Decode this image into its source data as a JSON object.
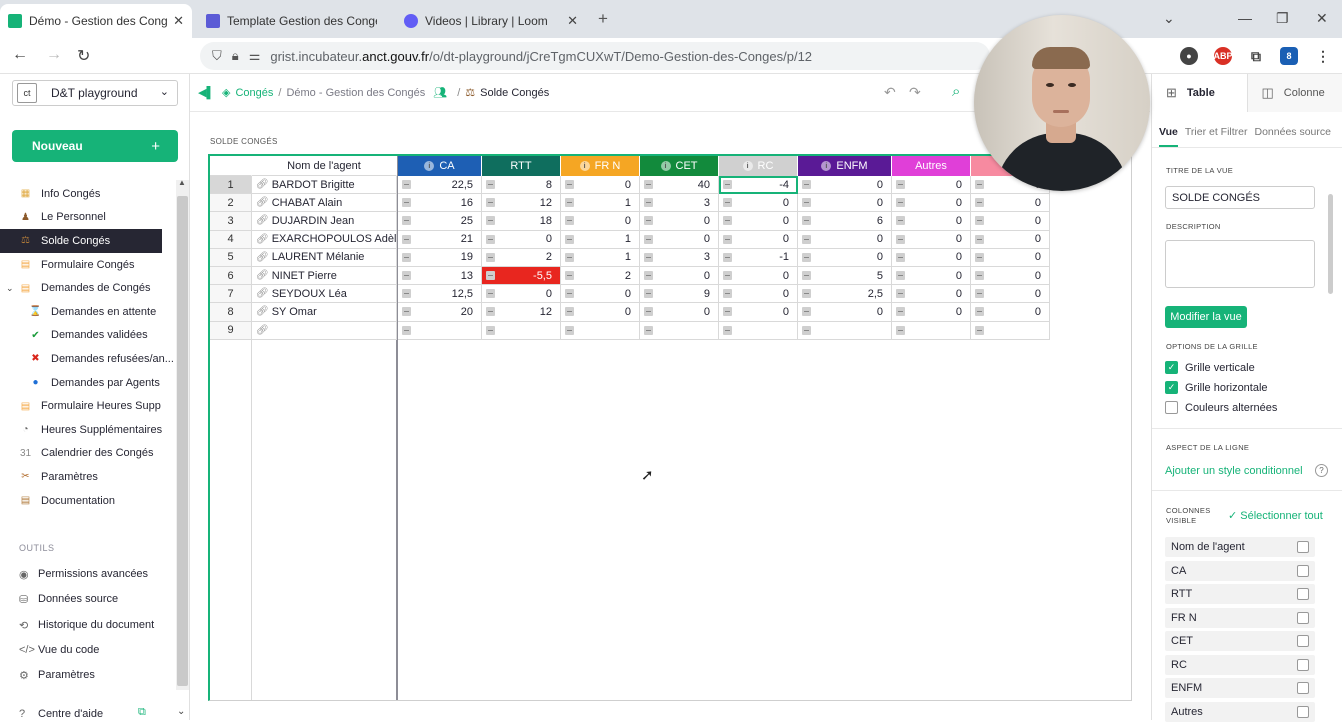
{
  "browser": {
    "tabs": [
      {
        "title": "Démo - Gestion des Congés - G",
        "icon_color": "#16b378"
      },
      {
        "title": "Template Gestion des Congés e",
        "icon_color": "#5b5bd6"
      },
      {
        "title": "Videos | Library | Loom",
        "icon_color": "#625df5"
      }
    ],
    "url_prefix": "grist.incubateur.",
    "url_domain": "anct.gouv.fr",
    "url_path": "/o/dt-playground/jCreTgmCUXwT/Demo-Gestion-des-Conges/p/12",
    "ext_badge": "8",
    "abp_label": "ABP"
  },
  "left": {
    "org_name": "D&T playground",
    "org_logo": "ct",
    "new_label": "Nouveau",
    "pages": [
      {
        "label": "Info Congés",
        "icon": "calendar-table-icon",
        "color": "#e0a940",
        "sub": false,
        "selected": false
      },
      {
        "label": "Le Personnel",
        "icon": "people-icon",
        "color": "#8b5a2b",
        "sub": false,
        "selected": false
      },
      {
        "label": "Solde Congés",
        "icon": "scale-icon",
        "color": "#b07a3a",
        "sub": false,
        "selected": true
      },
      {
        "label": "Formulaire Congés",
        "icon": "form-icon",
        "color": "#f4a640",
        "sub": false,
        "selected": false
      },
      {
        "label": "Demandes de Congés",
        "icon": "file-icon",
        "color": "#f4a640",
        "sub": false,
        "selected": false,
        "toggle": true
      },
      {
        "label": "Demandes en attente",
        "icon": "hourglass-icon",
        "color": "#c18a45",
        "sub": true,
        "selected": false
      },
      {
        "label": "Demandes validées",
        "icon": "checkmark-icon",
        "color": "#1a9b3a",
        "sub": true,
        "selected": false
      },
      {
        "label": "Demandes refusées/an...",
        "icon": "cross-icon",
        "color": "#d9261c",
        "sub": true,
        "selected": false
      },
      {
        "label": "Demandes par Agents",
        "icon": "globe-icon",
        "color": "#1e6fd6",
        "sub": true,
        "selected": false
      },
      {
        "label": "Formulaire Heures Supp",
        "icon": "form-icon",
        "color": "#f4a640",
        "sub": false,
        "selected": false
      },
      {
        "label": "Heures Supplémentaires",
        "icon": "stopwatch-icon",
        "color": "#666666",
        "sub": false,
        "selected": false
      },
      {
        "label": "Calendrier des Congés",
        "icon": "calendar-icon",
        "color": "#888888",
        "sub": false,
        "selected": false
      },
      {
        "label": "Paramètres",
        "icon": "tools-icon",
        "color": "#b06a2a",
        "sub": false,
        "selected": false
      },
      {
        "label": "Documentation",
        "icon": "document-icon",
        "color": "#b07a3a",
        "sub": false,
        "selected": false
      }
    ],
    "tools_title": "OUTILS",
    "tools": [
      {
        "label": "Permissions avancées",
        "icon": "eye-icon"
      },
      {
        "label": "Données source",
        "icon": "database-icon"
      },
      {
        "label": "Historique du document",
        "icon": "history-icon"
      },
      {
        "label": "Vue du code",
        "icon": "code-icon"
      },
      {
        "label": "Paramètres",
        "icon": "gear-icon"
      }
    ],
    "help_label": "Centre d'aide"
  },
  "topbar": {
    "crumb_site": "Congés",
    "crumb_doc": "Démo - Gestion des Congés",
    "crumb_page": "Solde Congés"
  },
  "grid": {
    "view_title": "SOLDE CONGÉS",
    "name_header": "Nom de l'agent",
    "columns": [
      {
        "label": "CA",
        "color": "#1e5fb4",
        "info": true
      },
      {
        "label": "RTT",
        "color": "#0f6e5e",
        "info": false
      },
      {
        "label": "FR N",
        "color": "#f5a623",
        "info": true
      },
      {
        "label": "CET",
        "color": "#128a3c",
        "info": true
      },
      {
        "label": "RC",
        "color": "#d0d0d0",
        "info": true
      },
      {
        "label": "ENFM",
        "color": "#5a1a96",
        "info": true
      },
      {
        "label": "Autres",
        "color": "#e03fd8",
        "info": false
      },
      {
        "label": "",
        "color": "#f78aa0",
        "info": false
      }
    ],
    "rows": [
      {
        "n": "1",
        "name": "BARDOT  Brigitte",
        "vals": [
          "22,5",
          "8",
          "0",
          "40",
          "-4",
          "0",
          "0",
          "0"
        ]
      },
      {
        "n": "2",
        "name": "CHABAT Alain",
        "vals": [
          "16",
          "12",
          "1",
          "3",
          "0",
          "0",
          "0",
          "0"
        ]
      },
      {
        "n": "3",
        "name": "DUJARDIN Jean",
        "vals": [
          "25",
          "18",
          "0",
          "0",
          "0",
          "6",
          "0",
          "0"
        ]
      },
      {
        "n": "4",
        "name": "EXARCHOPOULOS Adèle",
        "vals": [
          "21",
          "0",
          "1",
          "0",
          "0",
          "0",
          "0",
          "0"
        ]
      },
      {
        "n": "5",
        "name": "LAURENT Mélanie",
        "vals": [
          "19",
          "2",
          "1",
          "3",
          "-1",
          "0",
          "0",
          "0"
        ]
      },
      {
        "n": "6",
        "name": "NINET Pierre",
        "vals": [
          "13",
          "-5,5",
          "2",
          "0",
          "0",
          "5",
          "0",
          "0"
        ]
      },
      {
        "n": "7",
        "name": "SEYDOUX Léa",
        "vals": [
          "12,5",
          "0",
          "0",
          "9",
          "0",
          "2,5",
          "0",
          "0"
        ]
      },
      {
        "n": "8",
        "name": "SY Omar",
        "vals": [
          "20",
          "12",
          "0",
          "0",
          "0",
          "0",
          "0",
          "0"
        ]
      },
      {
        "n": "9",
        "name": "",
        "vals": [
          "",
          "",
          "",
          "",
          "",
          "",
          "",
          ""
        ]
      }
    ],
    "negative_highlight": {
      "row": 5,
      "col": 1,
      "color": "#e8261f"
    },
    "cursor": {
      "row": 0,
      "col": 4
    }
  },
  "right": {
    "tab_table": "Table",
    "tab_column": "Colonne",
    "sub_view": "Vue",
    "sub_sort": "Trier et Filtrer",
    "sub_source": "Données source",
    "title_label": "TITRE DE LA VUE",
    "title_value": "SOLDE CONGÉS",
    "desc_label": "DESCRIPTION",
    "modify_btn": "Modifier la vue",
    "grid_options_label": "OPTIONS DE LA GRILLE",
    "opt_vertical": "Grille verticale",
    "opt_horizontal": "Grille horizontale",
    "opt_alternate": "Couleurs alternées",
    "row_aspect_label": "ASPECT DE LA LIGNE",
    "add_cond_style": "Ajouter un style conditionnel",
    "visible_cols_label_1": "COLONNES",
    "visible_cols_label_2": "VISIBLE",
    "select_all": "✓ Sélectionner tout",
    "visible_cols": [
      "Nom de l'agent",
      "CA",
      "RTT",
      "FR N",
      "CET",
      "RC",
      "ENFM",
      "Autres"
    ]
  }
}
